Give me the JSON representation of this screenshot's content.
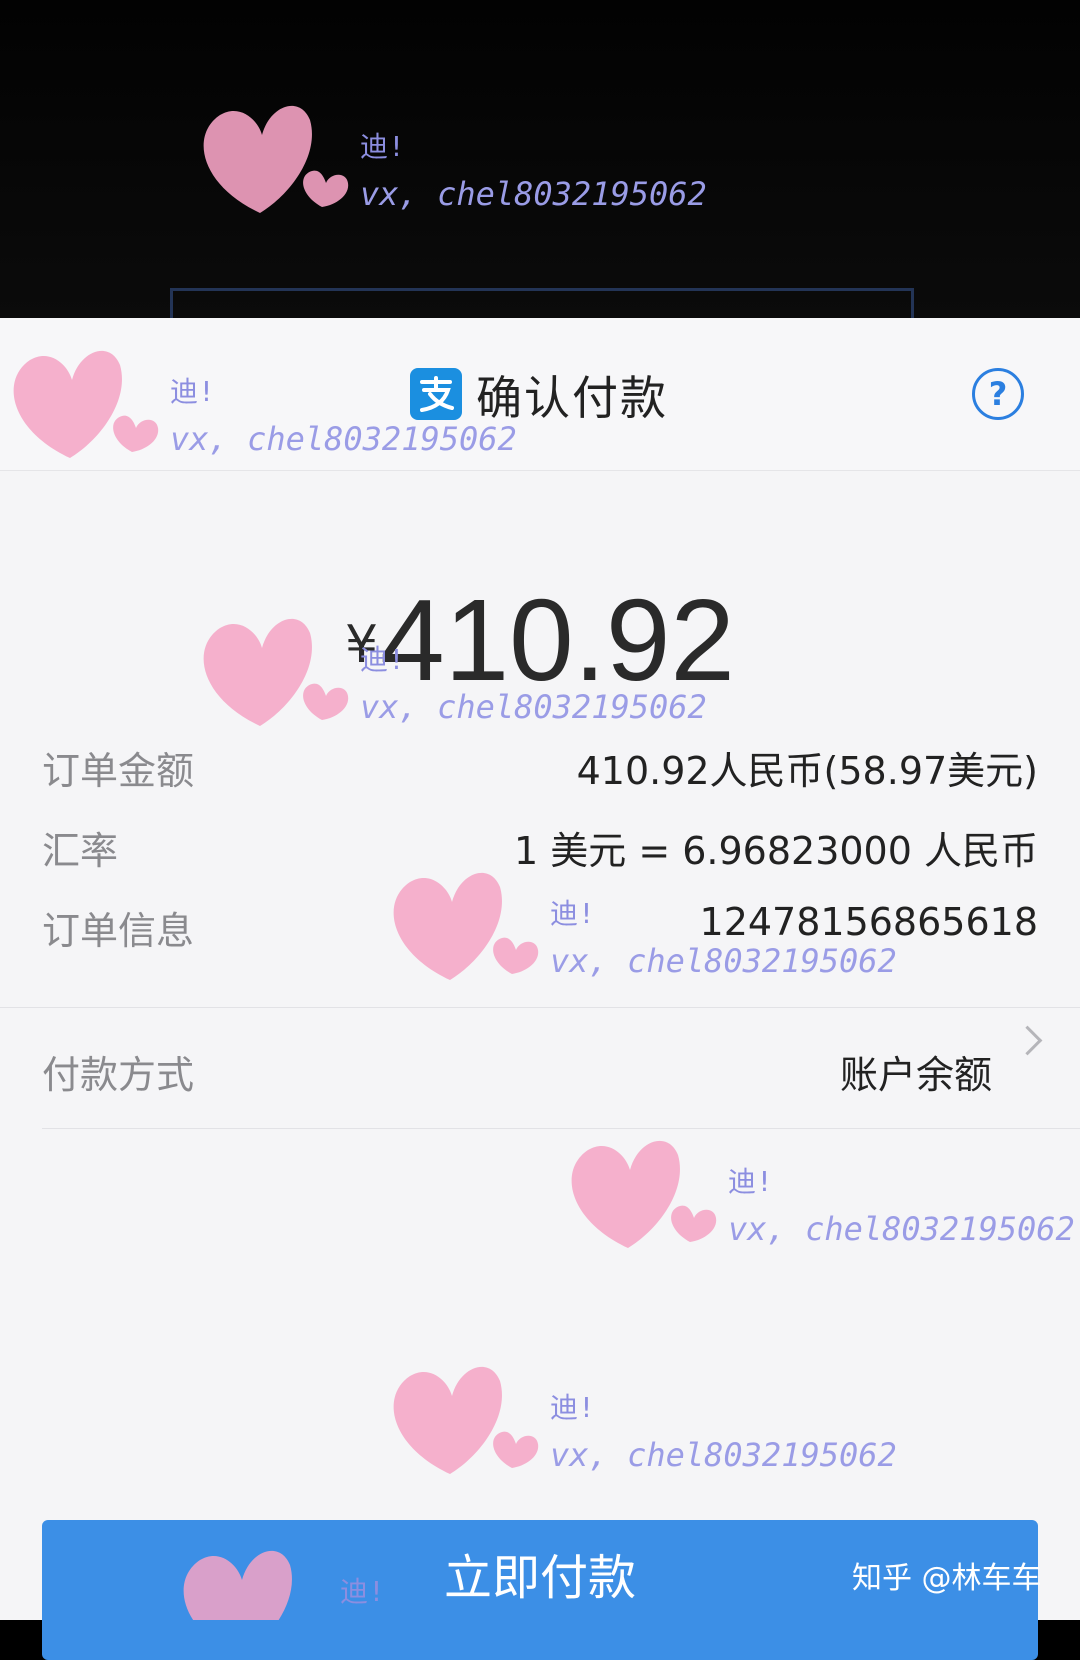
{
  "header": {
    "title": "确认付款",
    "help_label": "?"
  },
  "amount": {
    "currency_symbol": "¥",
    "value": "410.92"
  },
  "details": [
    {
      "label": "订单金额",
      "value": "410.92人民币(58.97美元)"
    },
    {
      "label": "汇率",
      "value": "1 美元 = 6.96823000 人民币"
    },
    {
      "label": "订单信息",
      "value": "12478156865618"
    }
  ],
  "payment_method": {
    "label": "付款方式",
    "value": "账户余额"
  },
  "pay_button_label": "立即付款",
  "watermark": {
    "line1": "迪!",
    "line2": "vx, chel8032195062",
    "source_credit": "知乎 @林车车"
  },
  "colors": {
    "accent": "#3c8fe6",
    "brand_logo": "#1b8fe0",
    "watermark_heart": "#f5a3c4",
    "watermark_text": "#9a9ce6"
  }
}
